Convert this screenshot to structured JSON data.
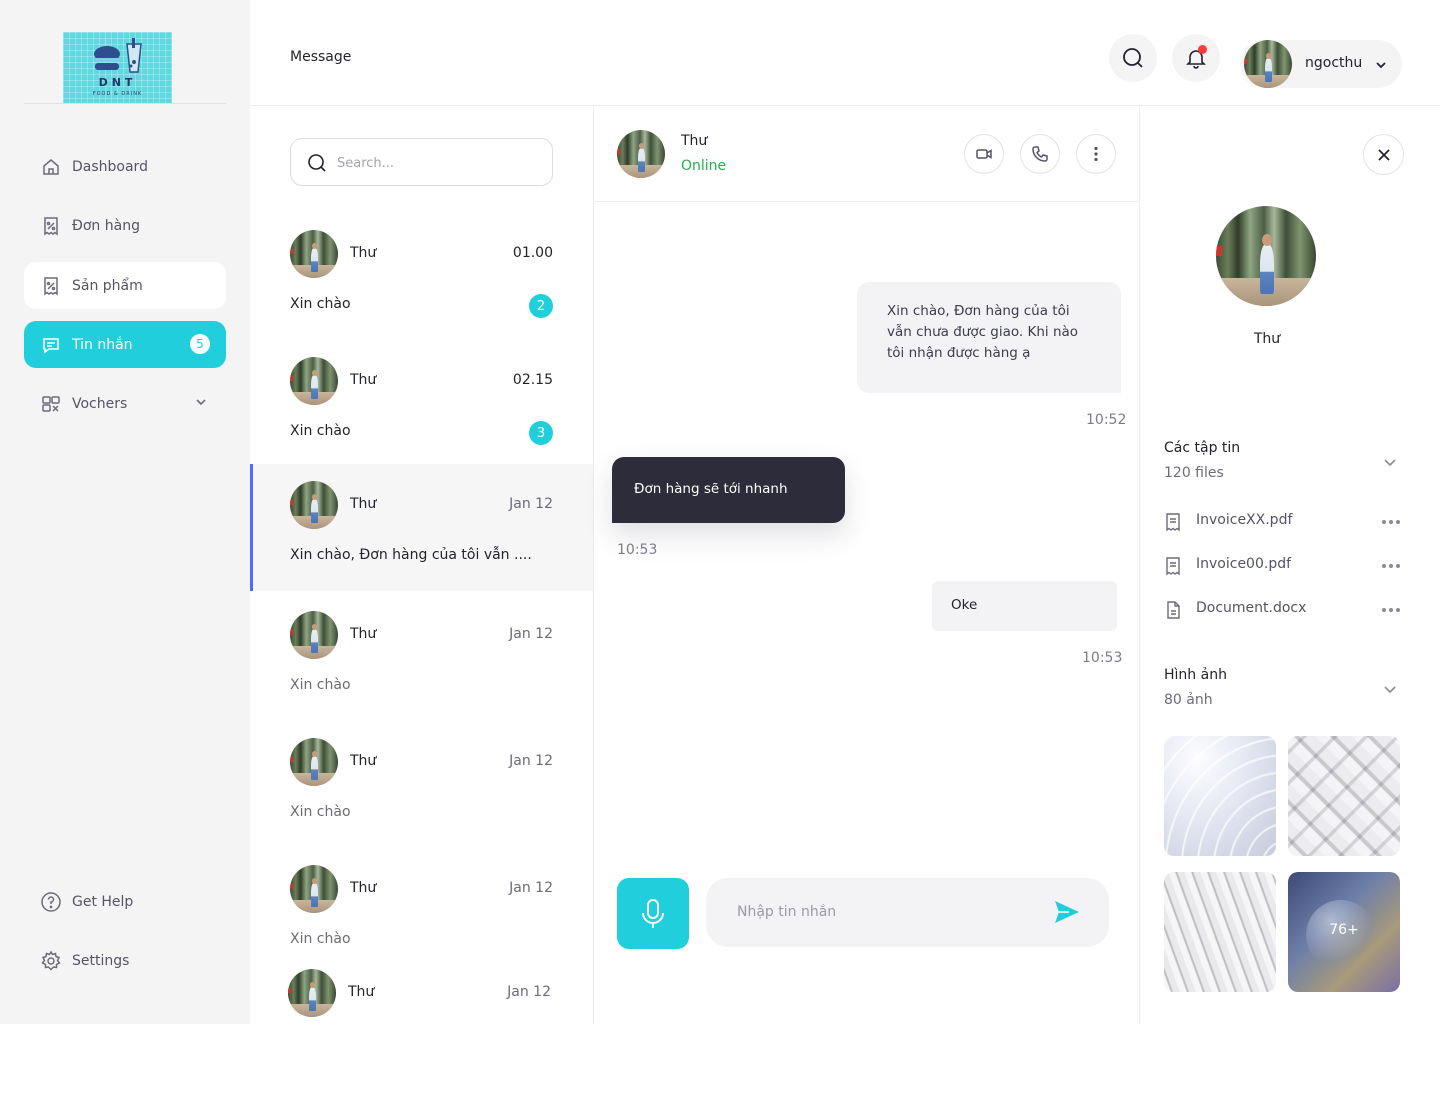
{
  "brand": {
    "name": "DNT",
    "tagline": "FOOD & DRINK"
  },
  "topbar": {
    "title": "Message",
    "user_name": "ngocthu"
  },
  "sidebar": {
    "items": [
      {
        "label": "Dashboard",
        "icon": "home-icon"
      },
      {
        "label": "Đơn hàng",
        "icon": "receipt-icon"
      },
      {
        "label": "Sản phẩm",
        "icon": "receipt-icon"
      },
      {
        "label": "Tin nhắn",
        "icon": "chat-icon",
        "badge": "5",
        "active": true
      },
      {
        "label": "Vochers",
        "icon": "voucher-icon",
        "has_dropdown": true
      }
    ],
    "bottom": [
      {
        "label": "Get Help",
        "icon": "help-icon"
      },
      {
        "label": "Settings",
        "icon": "gear-icon"
      }
    ]
  },
  "search": {
    "placeholder": "Search..."
  },
  "conversations": [
    {
      "name": "Thư",
      "time": "01.00",
      "message": "Xin chào",
      "unread": "2"
    },
    {
      "name": "Thư",
      "time": "02.15",
      "message": "Xin chào",
      "unread": "3"
    },
    {
      "name": "Thư",
      "time": "Jan 12",
      "message": "Xin chào, Đơn hàng của tôi vẫn ....",
      "active": true
    },
    {
      "name": "Thư",
      "time": "Jan 12",
      "message": "Xin chào"
    },
    {
      "name": "Thư",
      "time": "Jan 12",
      "message": "Xin chào"
    },
    {
      "name": "Thư",
      "time": "Jan 12",
      "message": "Xin chào"
    },
    {
      "name": "Thư",
      "time": "Jan 12"
    }
  ],
  "chat": {
    "name": "Thư",
    "status": "Online",
    "messages": [
      {
        "text": "Xin chào, Đơn hàng của tôi vẫn chưa được giao. Khi nào tôi nhận được hàng ạ",
        "time": "10:52",
        "side": "right"
      },
      {
        "text": "Đơn hàng sẽ tới nhanh",
        "time": "10:53",
        "side": "left"
      },
      {
        "text": "Oke",
        "time": "10:53",
        "side": "right"
      }
    ],
    "input_placeholder": "Nhập tin nhắn"
  },
  "details": {
    "name": "Thư",
    "files": {
      "title": "Các tập tin",
      "count": "120 files",
      "items": [
        "InvoiceXX.pdf",
        "Invoice00.pdf",
        "Document.docx"
      ]
    },
    "images": {
      "title": "Hình ảnh",
      "count": "80 ảnh",
      "more_label": "76+"
    }
  },
  "colors": {
    "accent": "#20CFDB",
    "active_border": "#4E6BFF",
    "online": "#22B14C",
    "notification": "#FF3B3B",
    "dark_bubble": "#2C2C3A"
  }
}
